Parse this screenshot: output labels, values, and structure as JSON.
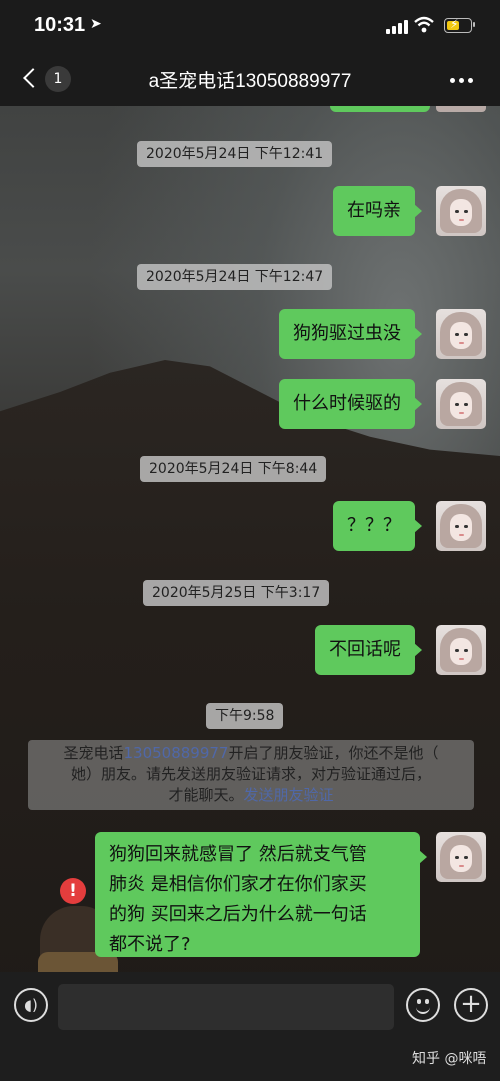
{
  "status_bar": {
    "time": "10:31"
  },
  "nav": {
    "unread_count": "1",
    "title": "a圣宠电话13050889977"
  },
  "messages": [
    {
      "type": "timestamp",
      "text": "2020年5月24日 下午12:41"
    },
    {
      "type": "sent",
      "text": "在吗亲"
    },
    {
      "type": "timestamp",
      "text": "2020年5月24日 下午12:47"
    },
    {
      "type": "sent",
      "text": "狗狗驱过虫没"
    },
    {
      "type": "sent",
      "text": "什么时候驱的"
    },
    {
      "type": "timestamp",
      "text": "2020年5月24日 下午8:44"
    },
    {
      "type": "sent",
      "text": "？？？"
    },
    {
      "type": "timestamp",
      "text": "2020年5月25日 下午3:17"
    },
    {
      "type": "sent",
      "text": "不回话呢"
    },
    {
      "type": "timestamp",
      "text": "下午9:58"
    }
  ],
  "system_notice": {
    "prefix": "圣宠电话",
    "phone": "13050889977",
    "line1_rest": "开启了朋友验证，你还不是他（",
    "line2": "她）朋友。请先发送朋友验证请求，对方验证通过后，",
    "line3_pre": "才能聊天。",
    "link": "发送朋友验证"
  },
  "failed_message": {
    "lines": [
      "狗狗回来就感冒了 然后就支气管",
      "肺炎 是相信你们家才在你们家买",
      "的狗 买回来之后为什么就一句话",
      "都不说了?"
    ],
    "status_icon": "!"
  },
  "input_bar": {
    "placeholder": "",
    "voice_icon": "◖)",
    "plus_icon": "+"
  },
  "watermark": "知乎 @咪唔",
  "colors": {
    "bubble": "#5fc95d",
    "fail": "#e43d3d",
    "link": "#5068a8"
  }
}
